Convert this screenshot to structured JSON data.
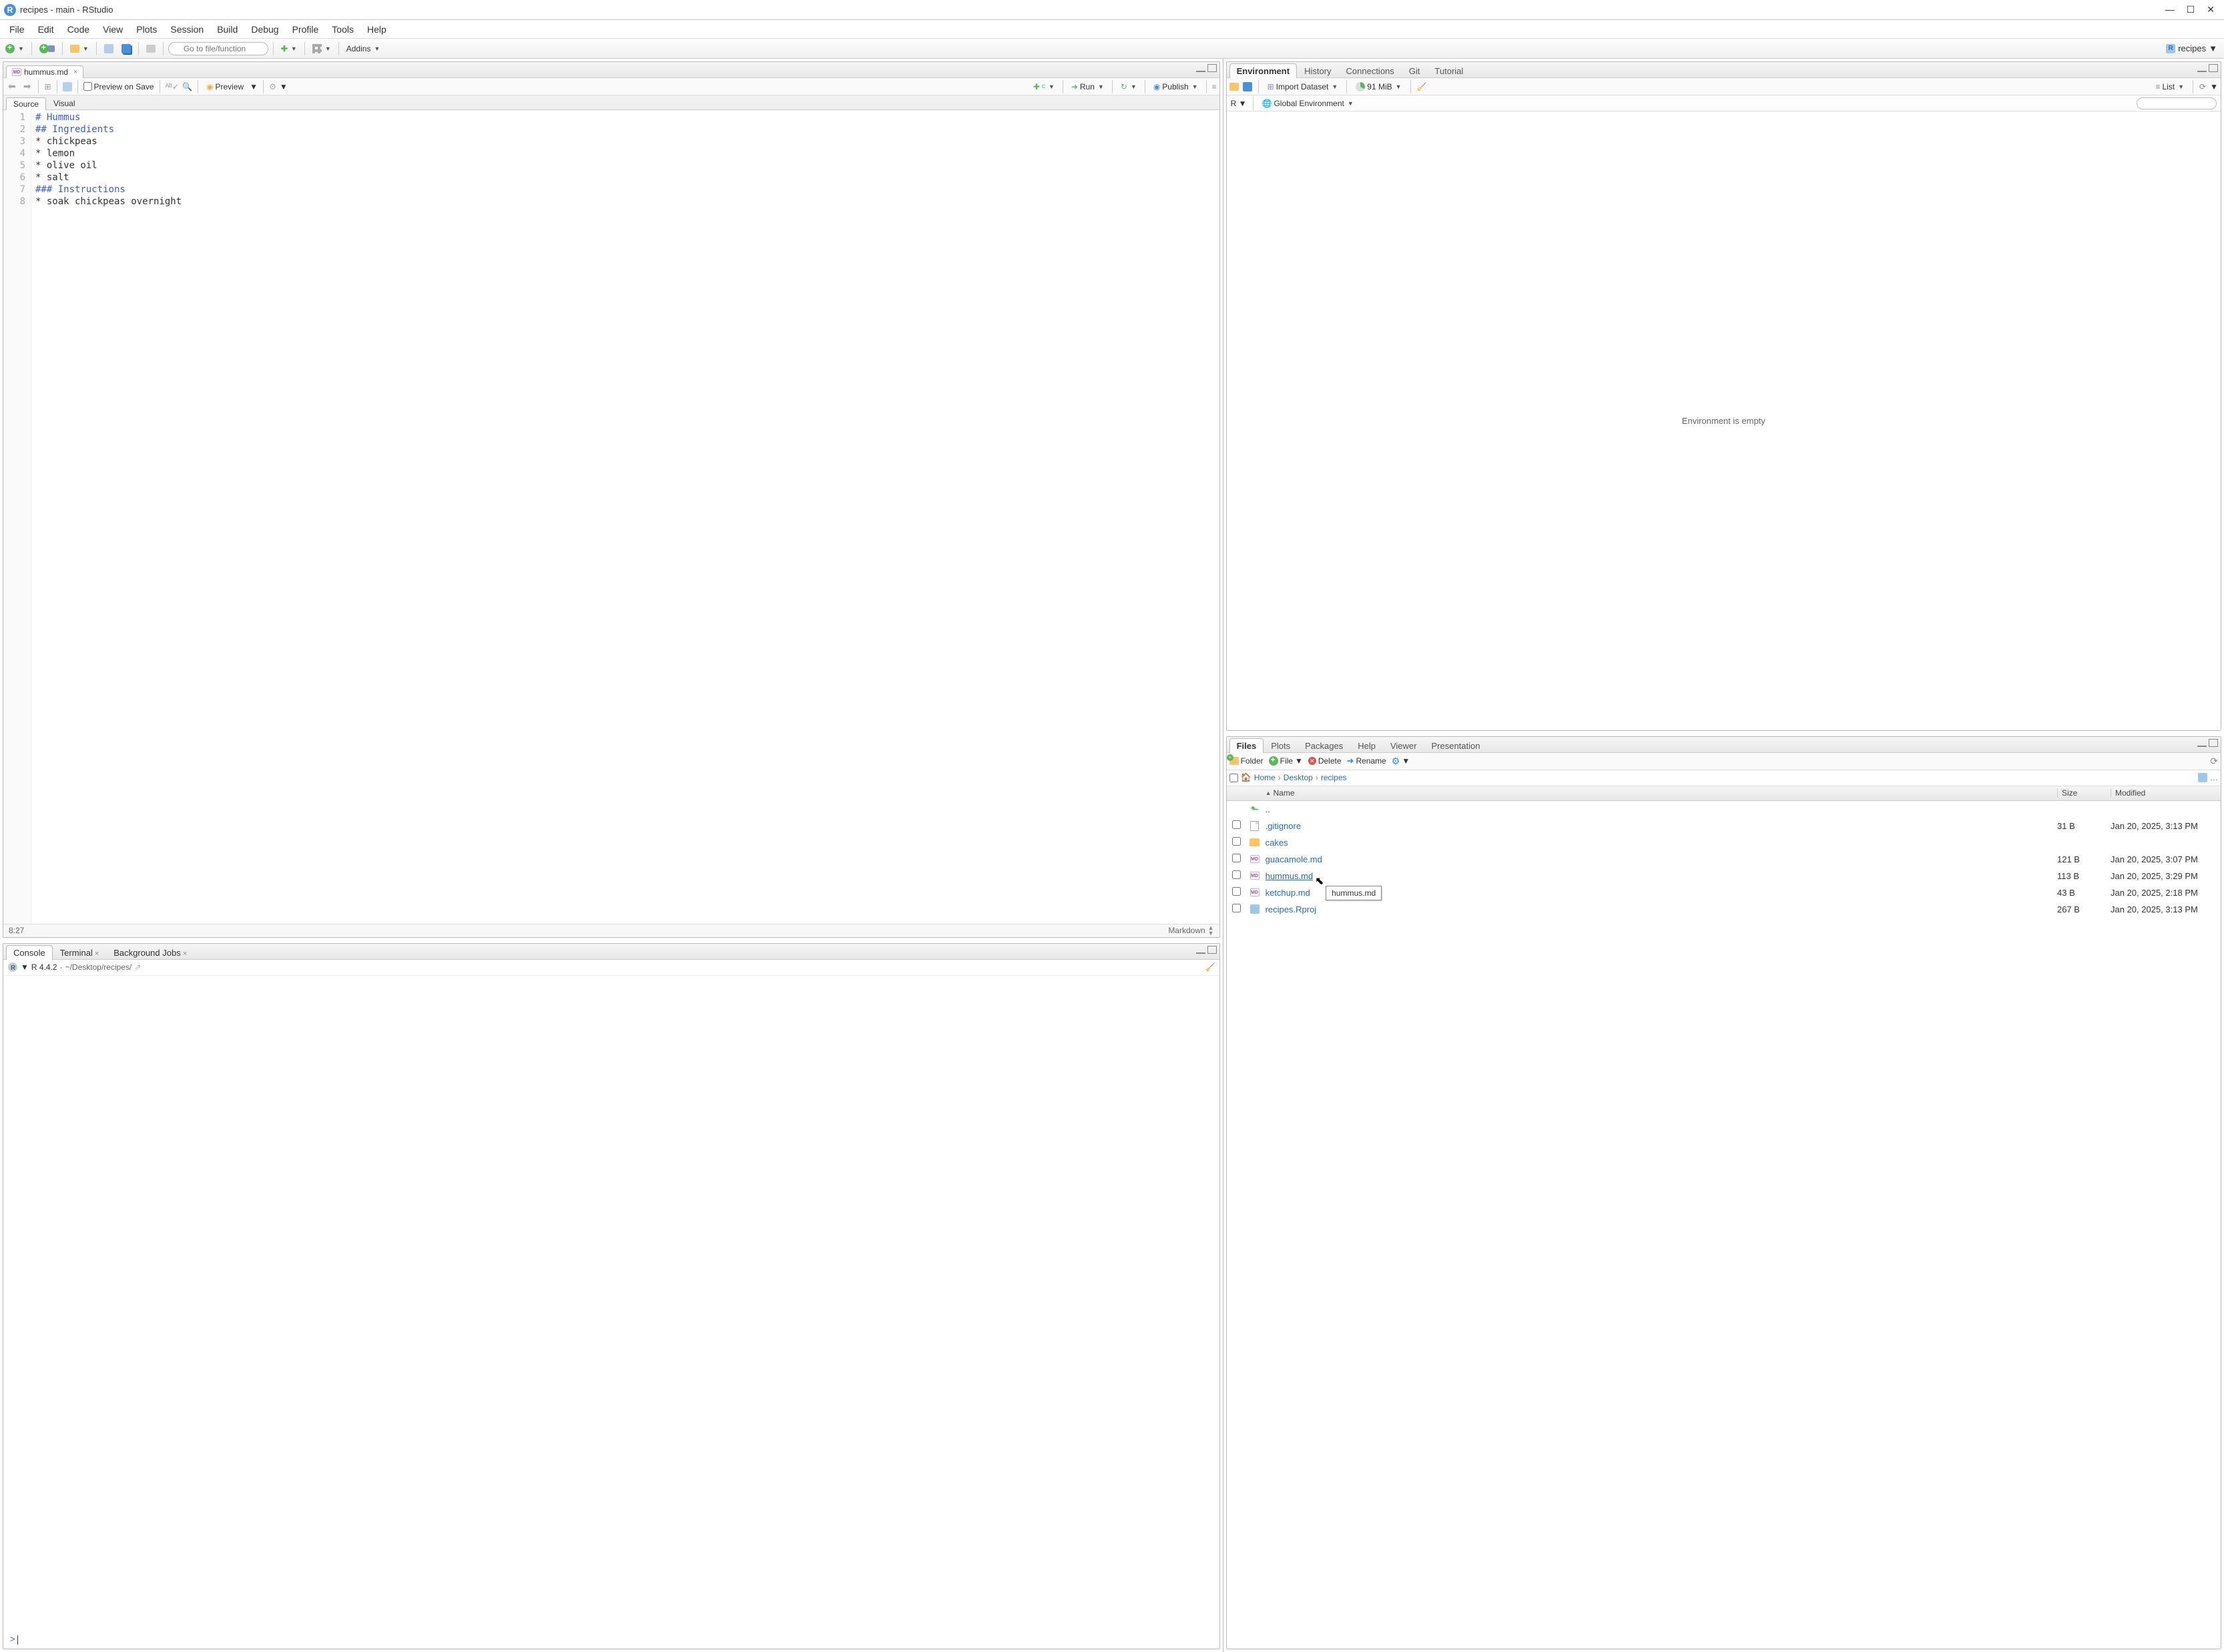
{
  "window": {
    "title": "recipes - main - RStudio"
  },
  "menubar": [
    "File",
    "Edit",
    "Code",
    "View",
    "Plots",
    "Session",
    "Build",
    "Debug",
    "Profile",
    "Tools",
    "Help"
  ],
  "maintoolbar": {
    "goto_placeholder": "Go to file/function",
    "addins_label": "Addins",
    "project_name": "recipes"
  },
  "source": {
    "tab_filename": "hummus.md",
    "preview_on_save": "Preview on Save",
    "preview_btn": "Preview",
    "run_btn": "Run",
    "publish_btn": "Publish",
    "subtabs": {
      "source": "Source",
      "visual": "Visual"
    },
    "lines": [
      {
        "n": "1",
        "cls": "hd",
        "text": "# Hummus"
      },
      {
        "n": "2",
        "cls": "hd",
        "text": "## Ingredients"
      },
      {
        "n": "3",
        "cls": "txt",
        "text": "* chickpeas"
      },
      {
        "n": "4",
        "cls": "txt",
        "text": "* lemon"
      },
      {
        "n": "5",
        "cls": "txt",
        "text": "* olive oil"
      },
      {
        "n": "6",
        "cls": "txt",
        "text": "* salt"
      },
      {
        "n": "7",
        "cls": "hd",
        "text": "### Instructions"
      },
      {
        "n": "8",
        "cls": "txt",
        "text": "* soak chickpeas overnight"
      }
    ],
    "status_cursor": "8:27",
    "status_mode": "Markdown"
  },
  "console": {
    "tabs": {
      "console": "Console",
      "terminal": "Terminal",
      "bgjobs": "Background Jobs"
    },
    "r_version": "R 4.4.2",
    "working_dir": "~/Desktop/recipes/",
    "prompt": ">"
  },
  "environment": {
    "tabs": [
      "Environment",
      "History",
      "Connections",
      "Git",
      "Tutorial"
    ],
    "import_label": "Import Dataset",
    "mem_usage": "91 MiB",
    "list_label": "List",
    "scope_r": "R",
    "scope_env": "Global Environment",
    "empty_msg": "Environment is empty"
  },
  "files": {
    "tabs": [
      "Files",
      "Plots",
      "Packages",
      "Help",
      "Viewer",
      "Presentation"
    ],
    "toolbar": {
      "folder": "Folder",
      "file": "File",
      "delete": "Delete",
      "rename": "Rename"
    },
    "breadcrumb": [
      "Home",
      "Desktop",
      "recipes"
    ],
    "columns": {
      "name": "Name",
      "size": "Size",
      "modified": "Modified"
    },
    "up_label": "..",
    "rows": [
      {
        "icon": "doc",
        "name": ".gitignore",
        "size": "31 B",
        "modified": "Jan 20, 2025, 3:13 PM"
      },
      {
        "icon": "folder",
        "name": "cakes",
        "size": "",
        "modified": ""
      },
      {
        "icon": "md",
        "name": "guacamole.md",
        "size": "121 B",
        "modified": "Jan 20, 2025, 3:07 PM"
      },
      {
        "icon": "md",
        "name": "hummus.md",
        "size": "113 B",
        "modified": "Jan 20, 2025, 3:29 PM",
        "hover": true
      },
      {
        "icon": "md",
        "name": "ketchup.md",
        "size": "43 B",
        "modified": "Jan 20, 2025, 2:18 PM"
      },
      {
        "icon": "rproj",
        "name": "recipes.Rproj",
        "size": "267 B",
        "modified": "Jan 20, 2025, 3:13 PM"
      }
    ],
    "tooltip": "hummus.md"
  }
}
